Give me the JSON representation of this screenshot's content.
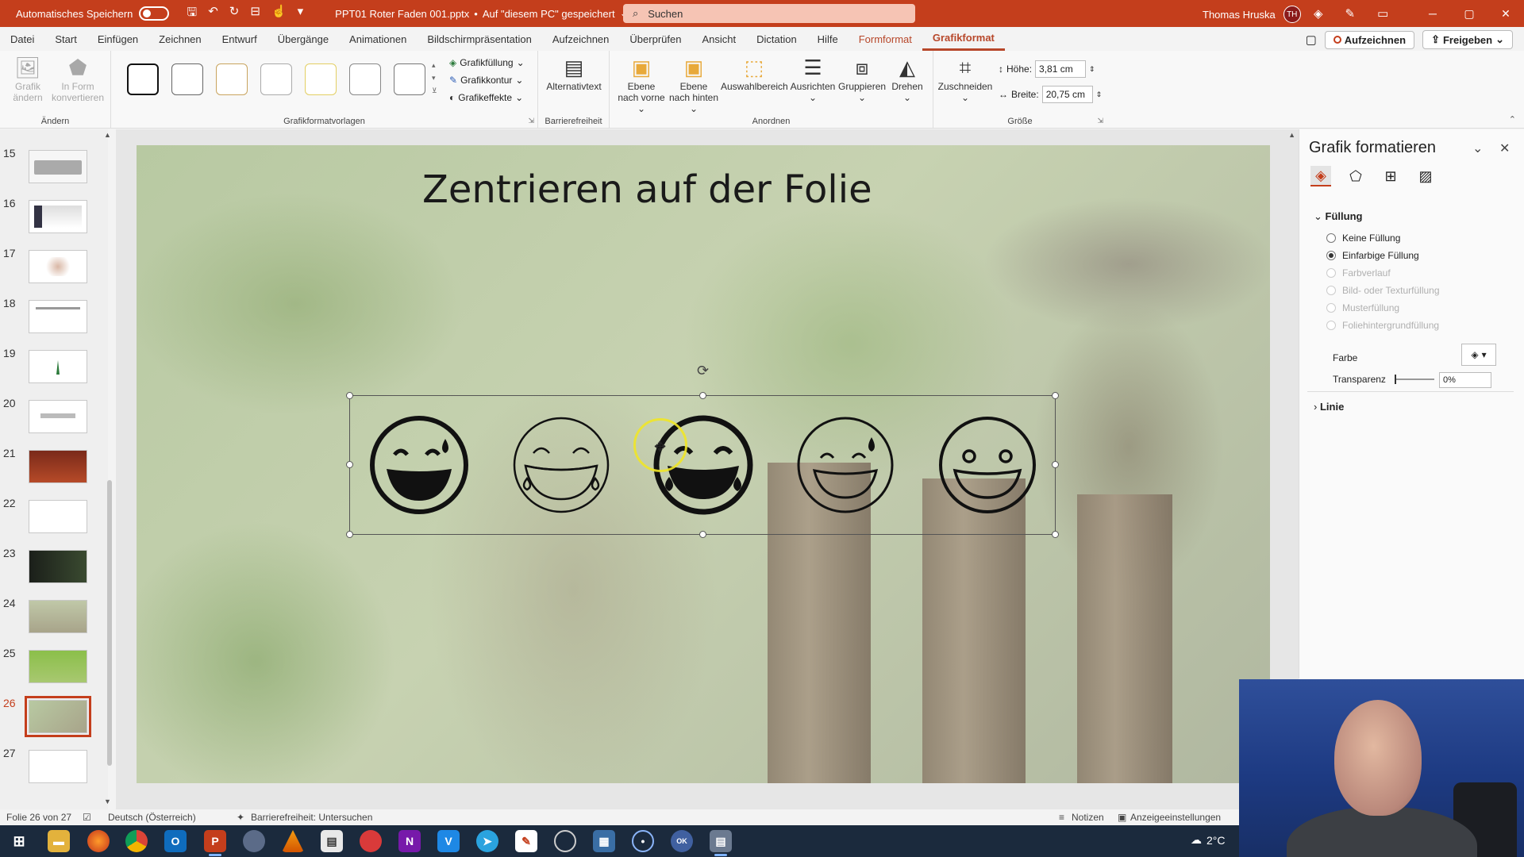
{
  "titlebar": {
    "autosave_label": "Automatisches Speichern",
    "doc_title": "PPT01 Roter Faden 001.pptx",
    "save_location": "Auf \"diesem PC\" gespeichert",
    "search_placeholder": "Suchen",
    "user_name": "Thomas Hruska",
    "user_initials": "TH"
  },
  "menu": {
    "tabs": [
      "Datei",
      "Start",
      "Einfügen",
      "Zeichnen",
      "Entwurf",
      "Übergänge",
      "Animationen",
      "Bildschirmpräsentation",
      "Aufzeichnen",
      "Überprüfen",
      "Ansicht",
      "Dictation",
      "Hilfe"
    ],
    "context_tab": "Formformat",
    "active_tab": "Grafikformat",
    "record_btn": "Aufzeichnen",
    "share_btn": "Freigeben"
  },
  "ribbon": {
    "aendern": {
      "label": "Ändern",
      "grafik_aendern": "Grafik ändern",
      "in_form": "In Form konvertieren"
    },
    "vorlagen": {
      "label": "Grafikformatvorlagen",
      "fuellung": "Grafikfüllung",
      "kontur": "Grafikkontur",
      "effekte": "Grafikeffekte"
    },
    "barriere": {
      "label": "Barrierefreiheit",
      "alt": "Alternativtext"
    },
    "anordnen": {
      "label": "Anordnen",
      "vorne": "Ebene nach vorne",
      "hinten": "Ebene nach hinten",
      "auswahl": "Auswahlbereich",
      "ausrichten": "Ausrichten",
      "gruppieren": "Gruppieren",
      "drehen": "Drehen"
    },
    "groesse": {
      "label": "Größe",
      "zuschneiden": "Zuschneiden",
      "hoehe_label": "Höhe:",
      "hoehe_value": "3,81 cm",
      "breite_label": "Breite:",
      "breite_value": "20,75 cm"
    }
  },
  "thumbnails": [
    "15",
    "16",
    "17",
    "18",
    "19",
    "20",
    "21",
    "22",
    "23",
    "24",
    "25",
    "26",
    "27"
  ],
  "selected_slide": "26",
  "slide": {
    "title": "Zentrieren auf der Folie"
  },
  "format_pane": {
    "title": "Grafik formatieren",
    "section_fill": "Füllung",
    "options": [
      "Keine Füllung",
      "Einfarbige Füllung",
      "Farbverlauf",
      "Bild- oder Texturfüllung",
      "Musterfüllung",
      "Foliehintergrundfüllung"
    ],
    "selected_option": "Einfarbige Füllung",
    "color_label": "Farbe",
    "transparency_label": "Transparenz",
    "transparency_value": "0%",
    "section_line": "Linie"
  },
  "status": {
    "slide_of": "Folie 26 von 27",
    "language": "Deutsch (Österreich)",
    "accessibility": "Barrierefreiheit: Untersuchen",
    "notes": "Notizen",
    "display": "Anzeigeeinstellungen"
  },
  "taskbar": {
    "temperature": "2°C"
  },
  "colors": {
    "accent": "#c43e1c",
    "ribbon_tab": "#b7472a"
  }
}
